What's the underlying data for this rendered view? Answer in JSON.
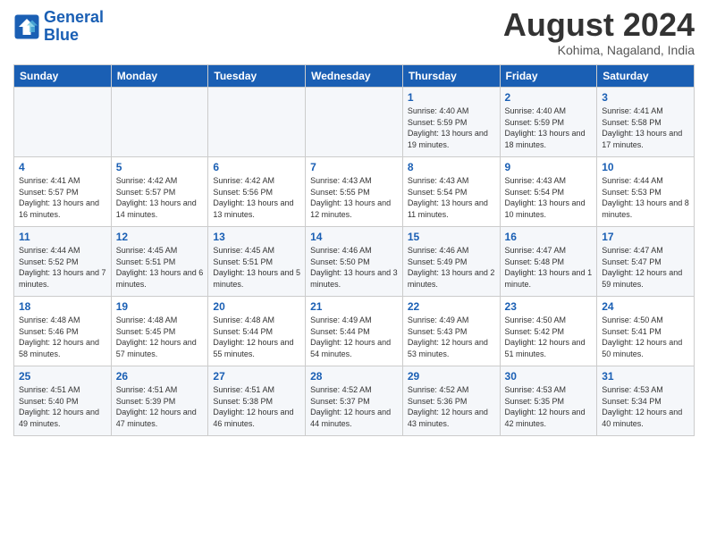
{
  "header": {
    "logo_line1": "General",
    "logo_line2": "Blue",
    "month": "August 2024",
    "location": "Kohima, Nagaland, India"
  },
  "weekdays": [
    "Sunday",
    "Monday",
    "Tuesday",
    "Wednesday",
    "Thursday",
    "Friday",
    "Saturday"
  ],
  "weeks": [
    [
      {
        "day": "",
        "sunrise": "",
        "sunset": "",
        "daylight": ""
      },
      {
        "day": "",
        "sunrise": "",
        "sunset": "",
        "daylight": ""
      },
      {
        "day": "",
        "sunrise": "",
        "sunset": "",
        "daylight": ""
      },
      {
        "day": "",
        "sunrise": "",
        "sunset": "",
        "daylight": ""
      },
      {
        "day": "1",
        "sunrise": "Sunrise: 4:40 AM",
        "sunset": "Sunset: 5:59 PM",
        "daylight": "Daylight: 13 hours and 19 minutes."
      },
      {
        "day": "2",
        "sunrise": "Sunrise: 4:40 AM",
        "sunset": "Sunset: 5:59 PM",
        "daylight": "Daylight: 13 hours and 18 minutes."
      },
      {
        "day": "3",
        "sunrise": "Sunrise: 4:41 AM",
        "sunset": "Sunset: 5:58 PM",
        "daylight": "Daylight: 13 hours and 17 minutes."
      }
    ],
    [
      {
        "day": "4",
        "sunrise": "Sunrise: 4:41 AM",
        "sunset": "Sunset: 5:57 PM",
        "daylight": "Daylight: 13 hours and 16 minutes."
      },
      {
        "day": "5",
        "sunrise": "Sunrise: 4:42 AM",
        "sunset": "Sunset: 5:57 PM",
        "daylight": "Daylight: 13 hours and 14 minutes."
      },
      {
        "day": "6",
        "sunrise": "Sunrise: 4:42 AM",
        "sunset": "Sunset: 5:56 PM",
        "daylight": "Daylight: 13 hours and 13 minutes."
      },
      {
        "day": "7",
        "sunrise": "Sunrise: 4:43 AM",
        "sunset": "Sunset: 5:55 PM",
        "daylight": "Daylight: 13 hours and 12 minutes."
      },
      {
        "day": "8",
        "sunrise": "Sunrise: 4:43 AM",
        "sunset": "Sunset: 5:54 PM",
        "daylight": "Daylight: 13 hours and 11 minutes."
      },
      {
        "day": "9",
        "sunrise": "Sunrise: 4:43 AM",
        "sunset": "Sunset: 5:54 PM",
        "daylight": "Daylight: 13 hours and 10 minutes."
      },
      {
        "day": "10",
        "sunrise": "Sunrise: 4:44 AM",
        "sunset": "Sunset: 5:53 PM",
        "daylight": "Daylight: 13 hours and 8 minutes."
      }
    ],
    [
      {
        "day": "11",
        "sunrise": "Sunrise: 4:44 AM",
        "sunset": "Sunset: 5:52 PM",
        "daylight": "Daylight: 13 hours and 7 minutes."
      },
      {
        "day": "12",
        "sunrise": "Sunrise: 4:45 AM",
        "sunset": "Sunset: 5:51 PM",
        "daylight": "Daylight: 13 hours and 6 minutes."
      },
      {
        "day": "13",
        "sunrise": "Sunrise: 4:45 AM",
        "sunset": "Sunset: 5:51 PM",
        "daylight": "Daylight: 13 hours and 5 minutes."
      },
      {
        "day": "14",
        "sunrise": "Sunrise: 4:46 AM",
        "sunset": "Sunset: 5:50 PM",
        "daylight": "Daylight: 13 hours and 3 minutes."
      },
      {
        "day": "15",
        "sunrise": "Sunrise: 4:46 AM",
        "sunset": "Sunset: 5:49 PM",
        "daylight": "Daylight: 13 hours and 2 minutes."
      },
      {
        "day": "16",
        "sunrise": "Sunrise: 4:47 AM",
        "sunset": "Sunset: 5:48 PM",
        "daylight": "Daylight: 13 hours and 1 minute."
      },
      {
        "day": "17",
        "sunrise": "Sunrise: 4:47 AM",
        "sunset": "Sunset: 5:47 PM",
        "daylight": "Daylight: 12 hours and 59 minutes."
      }
    ],
    [
      {
        "day": "18",
        "sunrise": "Sunrise: 4:48 AM",
        "sunset": "Sunset: 5:46 PM",
        "daylight": "Daylight: 12 hours and 58 minutes."
      },
      {
        "day": "19",
        "sunrise": "Sunrise: 4:48 AM",
        "sunset": "Sunset: 5:45 PM",
        "daylight": "Daylight: 12 hours and 57 minutes."
      },
      {
        "day": "20",
        "sunrise": "Sunrise: 4:48 AM",
        "sunset": "Sunset: 5:44 PM",
        "daylight": "Daylight: 12 hours and 55 minutes."
      },
      {
        "day": "21",
        "sunrise": "Sunrise: 4:49 AM",
        "sunset": "Sunset: 5:44 PM",
        "daylight": "Daylight: 12 hours and 54 minutes."
      },
      {
        "day": "22",
        "sunrise": "Sunrise: 4:49 AM",
        "sunset": "Sunset: 5:43 PM",
        "daylight": "Daylight: 12 hours and 53 minutes."
      },
      {
        "day": "23",
        "sunrise": "Sunrise: 4:50 AM",
        "sunset": "Sunset: 5:42 PM",
        "daylight": "Daylight: 12 hours and 51 minutes."
      },
      {
        "day": "24",
        "sunrise": "Sunrise: 4:50 AM",
        "sunset": "Sunset: 5:41 PM",
        "daylight": "Daylight: 12 hours and 50 minutes."
      }
    ],
    [
      {
        "day": "25",
        "sunrise": "Sunrise: 4:51 AM",
        "sunset": "Sunset: 5:40 PM",
        "daylight": "Daylight: 12 hours and 49 minutes."
      },
      {
        "day": "26",
        "sunrise": "Sunrise: 4:51 AM",
        "sunset": "Sunset: 5:39 PM",
        "daylight": "Daylight: 12 hours and 47 minutes."
      },
      {
        "day": "27",
        "sunrise": "Sunrise: 4:51 AM",
        "sunset": "Sunset: 5:38 PM",
        "daylight": "Daylight: 12 hours and 46 minutes."
      },
      {
        "day": "28",
        "sunrise": "Sunrise: 4:52 AM",
        "sunset": "Sunset: 5:37 PM",
        "daylight": "Daylight: 12 hours and 44 minutes."
      },
      {
        "day": "29",
        "sunrise": "Sunrise: 4:52 AM",
        "sunset": "Sunset: 5:36 PM",
        "daylight": "Daylight: 12 hours and 43 minutes."
      },
      {
        "day": "30",
        "sunrise": "Sunrise: 4:53 AM",
        "sunset": "Sunset: 5:35 PM",
        "daylight": "Daylight: 12 hours and 42 minutes."
      },
      {
        "day": "31",
        "sunrise": "Sunrise: 4:53 AM",
        "sunset": "Sunset: 5:34 PM",
        "daylight": "Daylight: 12 hours and 40 minutes."
      }
    ]
  ]
}
